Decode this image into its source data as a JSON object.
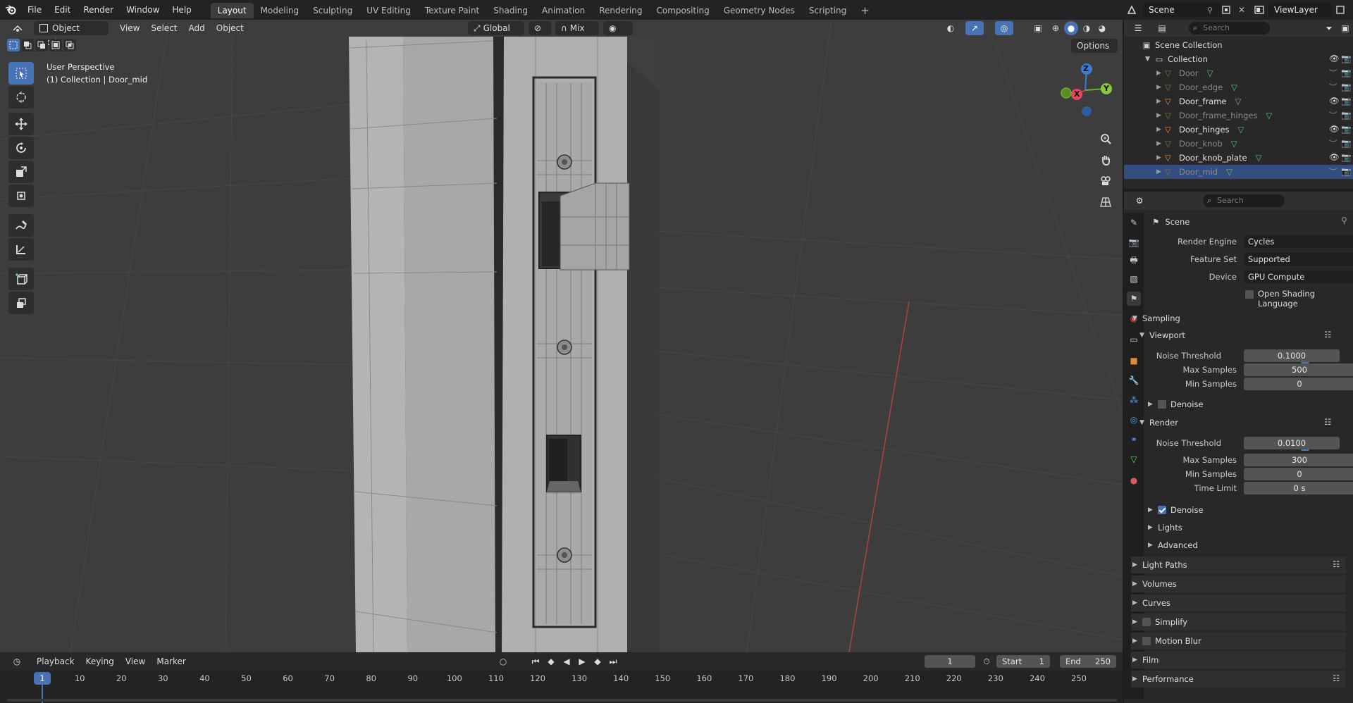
{
  "topbar": {
    "menus": [
      "File",
      "Edit",
      "Render",
      "Window",
      "Help"
    ],
    "workspaces": [
      "Layout",
      "Modeling",
      "Sculpting",
      "UV Editing",
      "Texture Paint",
      "Shading",
      "Animation",
      "Rendering",
      "Compositing",
      "Geometry Nodes",
      "Scripting"
    ],
    "active_workspace": "Layout",
    "scene_name": "Scene",
    "view_layer": "ViewLayer"
  },
  "viewport": {
    "mode": "Object Mode",
    "menus": [
      "View",
      "Select",
      "Add",
      "Object"
    ],
    "orientation": "Global",
    "snap_mode": "Mix",
    "options_label": "Options",
    "overlay_title": "User Perspective",
    "overlay_subtitle": "(1) Collection | Door_mid",
    "gizmo": {
      "x": "X",
      "y": "Y",
      "z": "Z"
    }
  },
  "outliner": {
    "search_placeholder": "Search",
    "scene_collection": "Scene Collection",
    "collection": "Collection",
    "items": [
      {
        "name": "Door",
        "visible": false,
        "selected": false
      },
      {
        "name": "Door_edge",
        "visible": false,
        "selected": false
      },
      {
        "name": "Door_frame",
        "visible": true,
        "selected": false
      },
      {
        "name": "Door_frame_hinges",
        "visible": false,
        "selected": false
      },
      {
        "name": "Door_hinges",
        "visible": true,
        "selected": false
      },
      {
        "name": "Door_knob",
        "visible": false,
        "selected": false
      },
      {
        "name": "Door_knob_plate",
        "visible": true,
        "selected": false
      },
      {
        "name": "Door_mid",
        "visible": false,
        "selected": true
      }
    ]
  },
  "properties": {
    "search_placeholder": "Search",
    "context": "Scene",
    "render_engine_label": "Render Engine",
    "render_engine": "Cycles",
    "feature_set_label": "Feature Set",
    "feature_set": "Supported",
    "device_label": "Device",
    "device": "GPU Compute",
    "osl_label": "Open Shading Language",
    "sampling": "Sampling",
    "viewport": {
      "title": "Viewport",
      "noise_threshold_label": "Noise Threshold",
      "noise_threshold": "0.1000",
      "max_samples_label": "Max Samples",
      "max_samples": "500",
      "min_samples_label": "Min Samples",
      "min_samples": "0",
      "denoise_label": "Denoise"
    },
    "render": {
      "title": "Render",
      "noise_threshold_label": "Noise Threshold",
      "noise_threshold": "0.0100",
      "max_samples_label": "Max Samples",
      "max_samples": "300",
      "min_samples_label": "Min Samples",
      "min_samples": "0",
      "time_limit_label": "Time Limit",
      "time_limit": "0 s",
      "denoise_label": "Denoise",
      "lights_label": "Lights",
      "advanced_label": "Advanced"
    },
    "sections": [
      "Light Paths",
      "Volumes",
      "Curves",
      "Simplify",
      "Motion Blur",
      "Film",
      "Performance"
    ]
  },
  "timeline": {
    "menus": [
      "Playback",
      "Keying",
      "View",
      "Marker"
    ],
    "current_frame": "1",
    "start_label": "Start",
    "start": "1",
    "end_label": "End",
    "end": "250",
    "ticks": [
      "1",
      "10",
      "20",
      "30",
      "40",
      "50",
      "60",
      "70",
      "80",
      "90",
      "100",
      "110",
      "120",
      "130",
      "140",
      "150",
      "160",
      "170",
      "180",
      "190",
      "200",
      "210",
      "220",
      "230",
      "240",
      "250"
    ]
  }
}
